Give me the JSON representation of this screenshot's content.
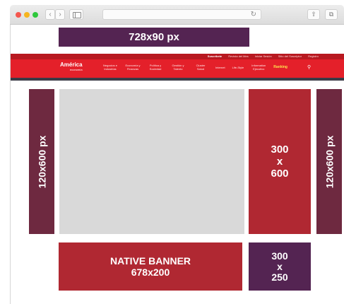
{
  "browser": {
    "back_icon": "chevron-left-icon",
    "forward_icon": "chevron-right-icon",
    "back_label": "‹",
    "forward_label": "›",
    "reload_label": "↻",
    "share_label": "⇧",
    "tabs_label": "⧉"
  },
  "ads": {
    "top_banner": "728x90 px",
    "skyscraper_left": "120x600 px",
    "skyscraper_right": "120x600 px",
    "half_page": "300\nx\n600",
    "native_banner": "NATIVE BANNER\n678x200",
    "mpu": "300\nx\n250"
  },
  "site": {
    "logo": "América",
    "logo_sub": "economía",
    "topbar_links": [
      "Suscríbete",
      "Revista del Mes",
      "Iniciar Sesión",
      "Sitio del Suscriptor",
      "Registro"
    ],
    "nav_items": [
      {
        "label": "Negocios e Industrias",
        "active": false
      },
      {
        "label": "Economía y Finanzas",
        "active": false
      },
      {
        "label": "Política y Sociedad",
        "active": false
      },
      {
        "label": "Gestión y Talento",
        "active": false
      },
      {
        "label": "Cluster Salud",
        "active": false
      },
      {
        "label": "Internet",
        "active": false
      },
      {
        "label": "Life-Style",
        "active": false
      },
      {
        "label": "Information Ejecutivo",
        "active": false
      },
      {
        "label": "Ranking",
        "active": true
      }
    ]
  },
  "colors": {
    "purple": "#542452",
    "plum": "#6e2940",
    "crimson": "#b02832",
    "site_red": "#e4202a",
    "placeholder_gray": "#d9d9d9"
  }
}
